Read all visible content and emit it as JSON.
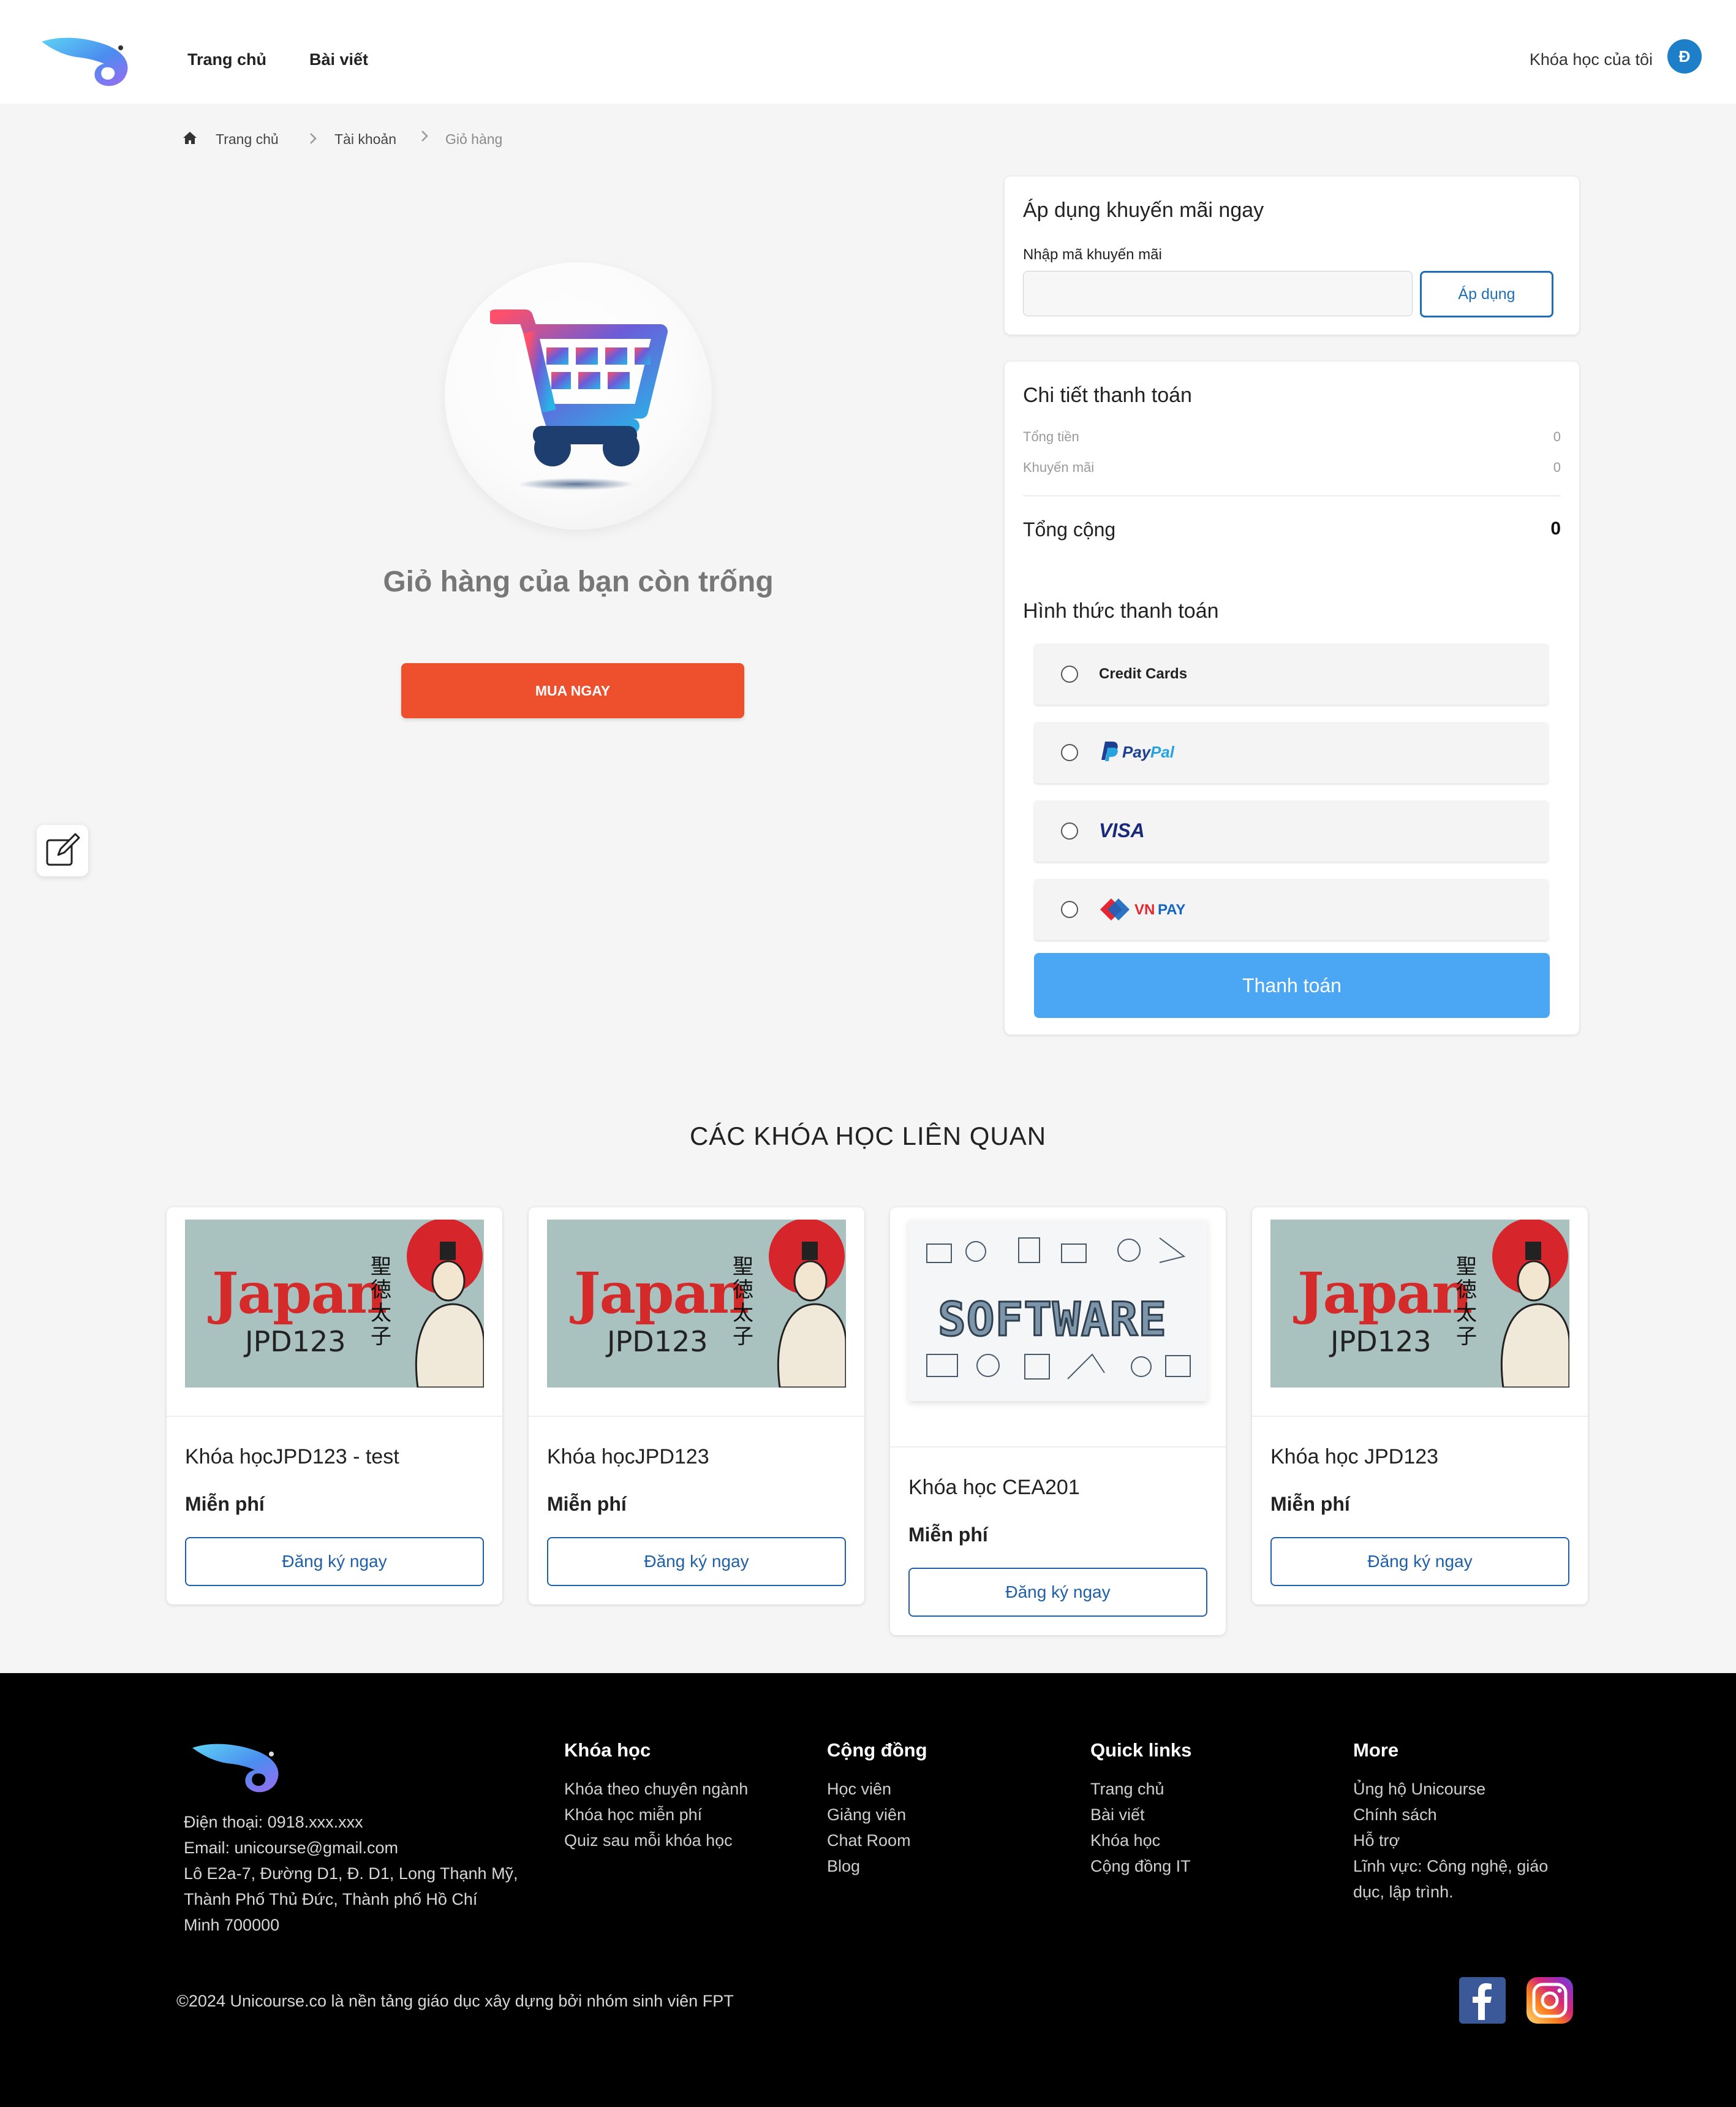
{
  "header": {
    "nav": [
      "Trang chủ",
      "Bài viết"
    ],
    "my_courses": "Khóa học của tôi",
    "avatar_letter": "Đ"
  },
  "breadcrumb": [
    "Trang chủ",
    "Tài khoản",
    "Giỏ hàng"
  ],
  "cart": {
    "empty_title": "Giỏ hàng của bạn còn trống",
    "buy_now": "MUA NGAY"
  },
  "promo": {
    "title": "Áp dụng khuyến mãi ngay",
    "label": "Nhập mã khuyến mãi",
    "placeholder": "",
    "apply": "Áp dụng"
  },
  "payment": {
    "title": "Chi tiết thanh toán",
    "subtotal_label": "Tổng tiền",
    "subtotal_value": "0",
    "discount_label": "Khuyến mãi",
    "discount_value": "0",
    "total_label": "Tổng cộng",
    "total_value": "0",
    "method_title": "Hình thức thanh toán",
    "methods": [
      "Credit Cards",
      "PayPal",
      "VISA",
      "VNPAY"
    ],
    "pay_button": "Thanh toán"
  },
  "related": {
    "title": "CÁC KHÓA HỌC LIÊN QUAN",
    "courses": [
      {
        "name": "Khóa họcJPD123 - test",
        "price": "Miễn phí",
        "cta": "Đăng ký ngay",
        "thumb_word": "Japan",
        "thumb_code": "JPD123",
        "thumb_kanji": "聖徳太子"
      },
      {
        "name": "Khóa họcJPD123",
        "price": "Miễn phí",
        "cta": "Đăng ký ngay",
        "thumb_word": "Japan",
        "thumb_code": "JPD123",
        "thumb_kanji": "聖徳太子"
      },
      {
        "name": "Khóa học CEA201",
        "price": "Miễn phí",
        "cta": "Đăng ký ngay",
        "thumb_word": "SOFTWARE"
      },
      {
        "name": "Khóa học JPD123",
        "price": "Miễn phí",
        "cta": "Đăng ký ngay",
        "thumb_word": "Japan",
        "thumb_code": "JPD123",
        "thumb_kanji": "聖徳太子"
      }
    ]
  },
  "footer": {
    "phone": "Điện thoại: 0918.xxx.xxx",
    "email": "Email: unicourse@gmail.com",
    "address_lines": [
      "Lô E2a-7, Đường D1, Đ. D1, Long Thạnh Mỹ,",
      "Thành Phố Thủ Đức, Thành phố Hồ Chí",
      "Minh 700000"
    ],
    "columns": [
      {
        "title": "Khóa học",
        "links": [
          "Khóa theo chuyên ngành",
          "Khóa học miễn phí",
          "Quiz sau mỗi khóa học"
        ]
      },
      {
        "title": "Cộng đồng",
        "links": [
          "Học viên",
          "Giảng viên",
          "Chat Room",
          "Blog"
        ]
      },
      {
        "title": "Quick links",
        "links": [
          "Trang chủ",
          "Bài viết",
          "Khóa học",
          "Cộng đồng IT"
        ]
      },
      {
        "title": "More",
        "links": [
          "Ủng hộ Unicourse",
          "Chính sách",
          "Hỗ trợ",
          "Lĩnh vực: Công nghệ, giáo",
          "dục, lập trình."
        ]
      }
    ],
    "copyright": "©2024 Unicourse.co là nền tảng giáo dục xây dựng bởi nhóm sinh viên FPT",
    "social": [
      "facebook-icon",
      "instagram-icon"
    ]
  },
  "colors": {
    "accent_orange": "#ee4f2c",
    "accent_blue": "#4ba6f4",
    "link_blue": "#1e5fa8",
    "avatar_blue": "#1e7fc9"
  }
}
